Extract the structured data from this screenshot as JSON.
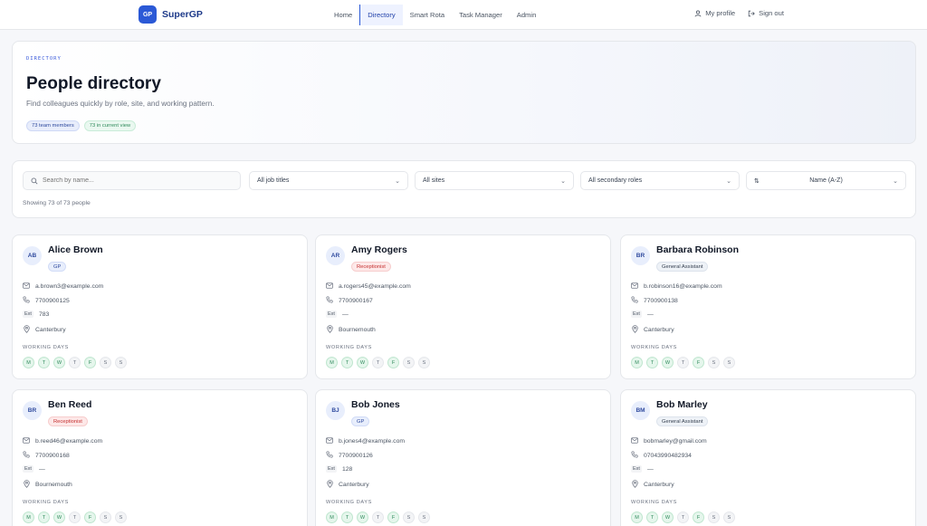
{
  "nav": {
    "brand_badge": "GP",
    "brand_name": "SuperGP",
    "links": [
      "Home",
      "Directory",
      "Smart Rota",
      "Task Manager",
      "Admin"
    ],
    "active": "Directory",
    "my_profile": "My profile",
    "sign_out": "Sign out"
  },
  "hero": {
    "eyebrow": "DIRECTORY",
    "title": "People directory",
    "subtitle": "Find colleagues quickly by role, site, and working pattern.",
    "team_members": "73 team members",
    "current_view": "73 in current view"
  },
  "filters": {
    "search_placeholder": "Search by name...",
    "job_titles": "All job titles",
    "sites": "All sites",
    "secondary_roles": "All secondary roles",
    "sort_icon": "⇅",
    "sort": "Name (A-Z)",
    "showing": "Showing 73 of 73 people"
  },
  "labels": {
    "ext": "Ext",
    "working_days": "WORKING DAYS"
  },
  "day_letters": [
    "M",
    "T",
    "W",
    "T",
    "F",
    "S",
    "S"
  ],
  "people": [
    {
      "initials": "AB",
      "name": "Alice Brown",
      "role": "GP",
      "role_kind": "gp",
      "email": "a.brown3@example.com",
      "phone": "7700900125",
      "ext": "783",
      "site": "Canterbury",
      "days": [
        1,
        1,
        1,
        0,
        1,
        0,
        0
      ]
    },
    {
      "initials": "AR",
      "name": "Amy Rogers",
      "role": "Receptionist",
      "role_kind": "rec",
      "email": "a.rogers45@example.com",
      "phone": "7700900167",
      "ext": "—",
      "site": "Bournemouth",
      "days": [
        1,
        1,
        1,
        0,
        1,
        0,
        0
      ]
    },
    {
      "initials": "BR",
      "name": "Barbara Robinson",
      "role": "General Assistant",
      "role_kind": "ga",
      "email": "b.robinson16@example.com",
      "phone": "7700900138",
      "ext": "—",
      "site": "Canterbury",
      "days": [
        1,
        1,
        1,
        0,
        1,
        0,
        0
      ]
    },
    {
      "initials": "BR",
      "name": "Ben Reed",
      "role": "Receptionist",
      "role_kind": "rec",
      "email": "b.reed46@example.com",
      "phone": "7700900168",
      "ext": "—",
      "site": "Bournemouth",
      "days": [
        1,
        1,
        1,
        0,
        1,
        0,
        0
      ]
    },
    {
      "initials": "BJ",
      "name": "Bob Jones",
      "role": "GP",
      "role_kind": "gp",
      "email": "b.jones4@example.com",
      "phone": "7700900126",
      "ext": "128",
      "site": "Canterbury",
      "days": [
        1,
        1,
        1,
        0,
        1,
        0,
        0
      ]
    },
    {
      "initials": "BM",
      "name": "Bob Marley",
      "role": "General Assistant",
      "role_kind": "ga",
      "email": "bobmarley@gmail.com",
      "phone": "07043990482934",
      "ext": "—",
      "site": "Canterbury",
      "days": [
        1,
        1,
        1,
        0,
        1,
        0,
        0
      ]
    }
  ],
  "colors": {
    "accent": "#2b59d6",
    "working_day": "#e5f6ec",
    "off_day": "#f3f4f6"
  }
}
